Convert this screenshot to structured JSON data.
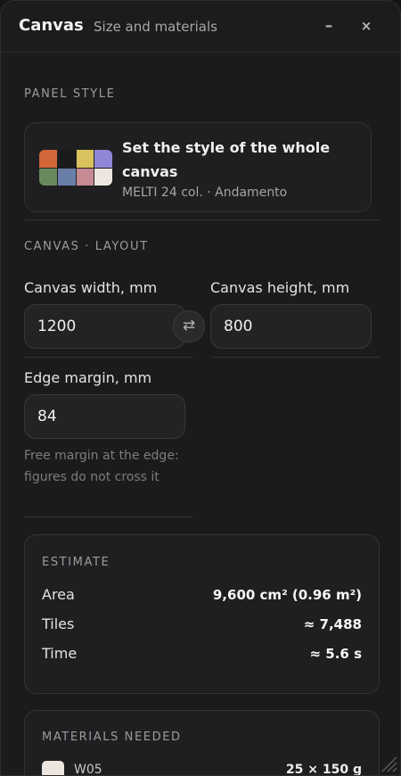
{
  "window": {
    "title": "Canvas",
    "subtitle": "Size and materials",
    "minimize_label": "–",
    "close_label": "×"
  },
  "panel_style": {
    "section_label": "PANEL STYLE",
    "title": "Set the style of the whole canvas",
    "meta": "MELTI 24 col. · Andamento",
    "swatch_colors": [
      "#d4673a",
      "#1b1b1c",
      "#d9c25d",
      "#8f86d6",
      "#6a8a5e",
      "#6a7fa8",
      "#c58a92",
      "#ece6de"
    ]
  },
  "layout": {
    "section_label": "CANVAS · LAYOUT",
    "width_label": "Canvas width, mm",
    "width_value": "1200",
    "height_label": "Canvas height, mm",
    "height_value": "800",
    "swap_icon": "⇄",
    "margin_label": "Edge margin, mm",
    "margin_value": "84",
    "margin_hint": "Free margin at the edge: figures do not cross it"
  },
  "estimate": {
    "label": "ESTIMATE",
    "rows": [
      {
        "label": "Area",
        "value": "9,600 cm² (0.96 m²)"
      },
      {
        "label": "Tiles",
        "value": "≈ 7,488"
      },
      {
        "label": "Time",
        "value": "≈ 5.6 s"
      }
    ]
  },
  "materials": {
    "label": "MATERIALS NEEDED",
    "items": [
      {
        "name": "W05",
        "qty": "25 × 150 g",
        "color": "#ece6de"
      }
    ]
  }
}
